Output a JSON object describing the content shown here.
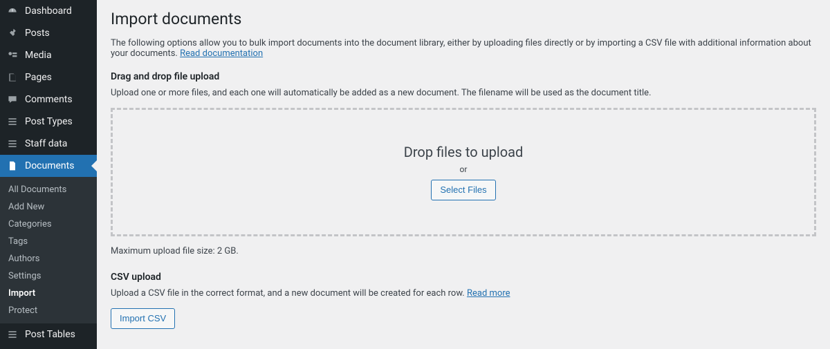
{
  "sidebar": {
    "items": [
      {
        "icon": "dashboard-icon",
        "label": "Dashboard"
      },
      {
        "icon": "pin-icon",
        "label": "Posts"
      },
      {
        "icon": "media-icon",
        "label": "Media"
      },
      {
        "icon": "page-icon",
        "label": "Pages"
      },
      {
        "icon": "comment-icon",
        "label": "Comments"
      },
      {
        "icon": "list-icon",
        "label": "Post Types"
      },
      {
        "icon": "list-icon",
        "label": "Staff data"
      },
      {
        "icon": "document-icon",
        "label": "Documents",
        "current": true
      },
      {
        "icon": "list-icon",
        "label": "Post Tables"
      }
    ],
    "submenu": [
      {
        "label": "All Documents"
      },
      {
        "label": "Add New"
      },
      {
        "label": "Categories"
      },
      {
        "label": "Tags"
      },
      {
        "label": "Authors"
      },
      {
        "label": "Settings"
      },
      {
        "label": "Import",
        "current": true
      },
      {
        "label": "Protect"
      }
    ]
  },
  "page": {
    "title": "Import documents",
    "intro_text": "The following options allow you to bulk import documents into the document library, either by uploading files directly or by importing a CSV file with additional information about your documents. ",
    "intro_link": "Read documentation",
    "section1_heading": "Drag and drop file upload",
    "section1_desc": "Upload one or more files, and each one will automatically be added as a new document. The filename will be used as the document title.",
    "drop_title": "Drop files to upload",
    "drop_or": "or",
    "select_files_btn": "Select Files",
    "max_note": "Maximum upload file size: 2 GB.",
    "section2_heading": "CSV upload",
    "section2_desc_text": "Upload a CSV file in the correct format, and a new document will be created for each row. ",
    "section2_desc_link": "Read more",
    "import_csv_btn": "Import CSV"
  }
}
